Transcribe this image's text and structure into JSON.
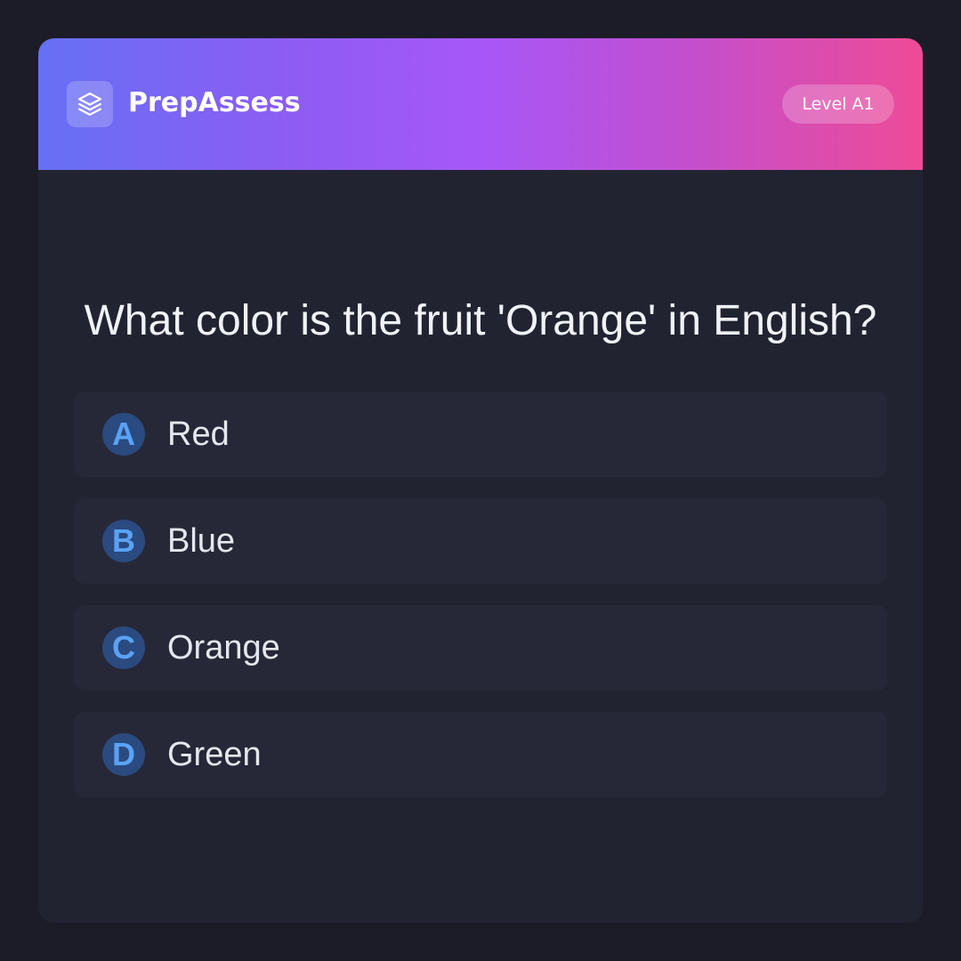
{
  "header": {
    "brand_name": "PrepAssess",
    "logo_icon": "layers-icon",
    "level_badge": "Level A1"
  },
  "question": {
    "text": "What color is the fruit 'Orange' in English?"
  },
  "options": [
    {
      "letter": "A",
      "label": "Red"
    },
    {
      "letter": "B",
      "label": "Blue"
    },
    {
      "letter": "C",
      "label": "Orange"
    },
    {
      "letter": "D",
      "label": "Green"
    }
  ],
  "colors": {
    "background": "#1b1c27",
    "card": "#212331",
    "option_bg": "#262837",
    "letter_circle": "#2a4a80",
    "letter_text": "#5aa2f4",
    "header_gradient": [
      "#6670f5",
      "#a757f8",
      "#ee4b96"
    ]
  }
}
